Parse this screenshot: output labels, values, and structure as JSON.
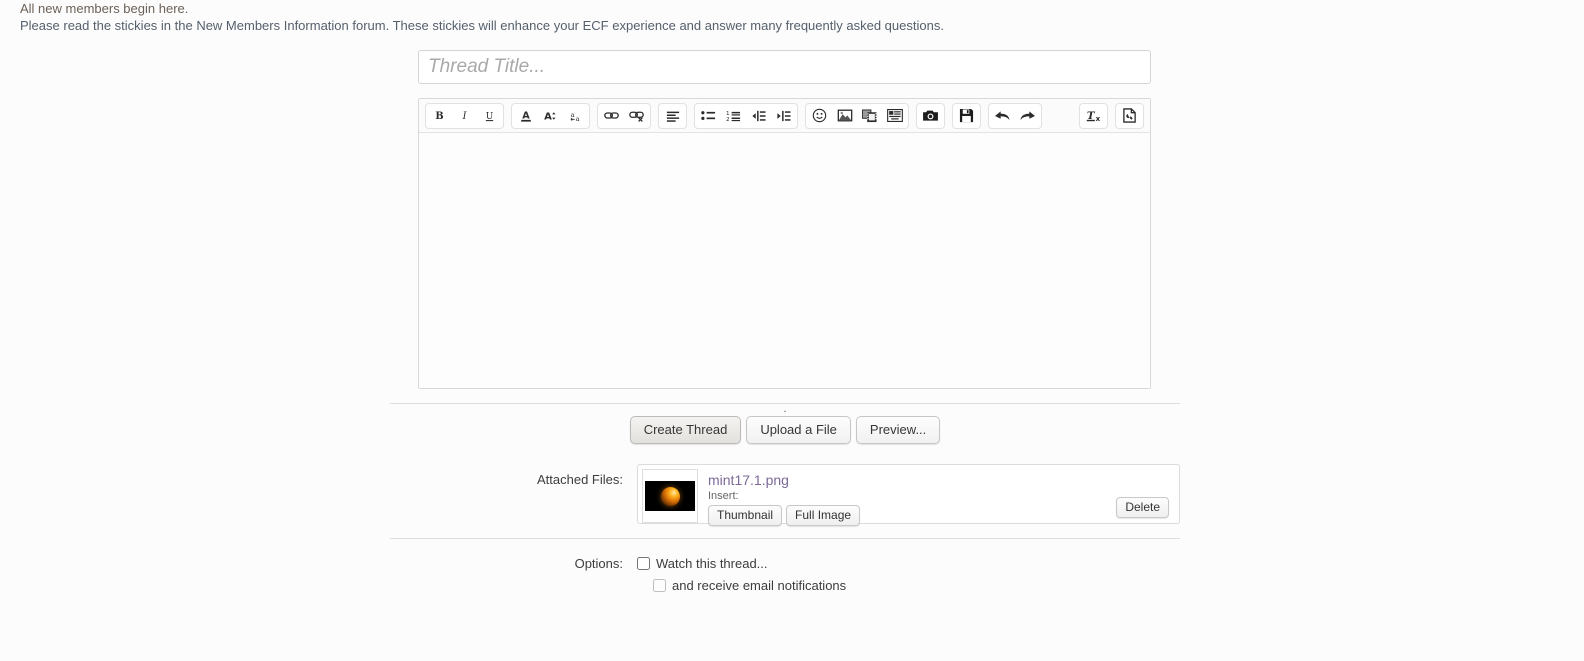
{
  "notice": {
    "line1": "All new members begin here.",
    "line2": "Please read the stickies in the New Members Information forum. These stickies will enhance your ECF experience and answer many frequently asked questions."
  },
  "thread": {
    "title_value": "",
    "title_placeholder": "Thread Title..."
  },
  "editor": {
    "content": "",
    "toolbar": {
      "groups": [
        {
          "name": "text-style",
          "buttons": [
            {
              "name": "bold-icon",
              "label": "B",
              "title": "Bold"
            },
            {
              "name": "italic-icon",
              "label": "I",
              "title": "Italic"
            },
            {
              "name": "underline-icon",
              "label": "U",
              "title": "Underline"
            }
          ]
        },
        {
          "name": "font",
          "buttons": [
            {
              "name": "text-color-icon",
              "label": "A",
              "title": "Text color"
            },
            {
              "name": "font-size-icon",
              "label": "A",
              "title": "Font size"
            },
            {
              "name": "font-family-icon",
              "label": "a",
              "title": "Font family"
            }
          ]
        },
        {
          "name": "link",
          "buttons": [
            {
              "name": "link-icon",
              "label": "",
              "title": "Insert link"
            },
            {
              "name": "unlink-icon",
              "label": "",
              "title": "Remove link"
            }
          ]
        },
        {
          "name": "align",
          "buttons": [
            {
              "name": "align-left-icon",
              "label": "",
              "title": "Alignment"
            }
          ]
        },
        {
          "name": "lists",
          "buttons": [
            {
              "name": "bullet-list-icon",
              "label": "",
              "title": "Bulleted list"
            },
            {
              "name": "numbered-list-icon",
              "label": "",
              "title": "Numbered list"
            },
            {
              "name": "outdent-icon",
              "label": "",
              "title": "Decrease indent"
            },
            {
              "name": "indent-icon",
              "label": "",
              "title": "Increase indent"
            }
          ]
        },
        {
          "name": "insert",
          "buttons": [
            {
              "name": "smiley-icon",
              "label": "",
              "title": "Insert smilies"
            },
            {
              "name": "image-icon",
              "label": "",
              "title": "Insert image"
            },
            {
              "name": "media-icon",
              "label": "",
              "title": "Insert media"
            },
            {
              "name": "quote-icon",
              "label": "",
              "title": "Insert quote"
            }
          ]
        },
        {
          "name": "camera",
          "buttons": [
            {
              "name": "camera-icon",
              "label": "",
              "title": "Take screenshot"
            }
          ]
        },
        {
          "name": "save",
          "buttons": [
            {
              "name": "save-floppy-icon",
              "label": "",
              "title": "Save draft"
            }
          ]
        },
        {
          "name": "history",
          "buttons": [
            {
              "name": "undo-icon",
              "label": "",
              "title": "Undo"
            },
            {
              "name": "redo-icon",
              "label": "",
              "title": "Redo"
            }
          ]
        }
      ],
      "right_groups": [
        {
          "name": "clear-format",
          "buttons": [
            {
              "name": "remove-formatting-icon",
              "label": "",
              "title": "Remove formatting"
            }
          ]
        },
        {
          "name": "draft",
          "buttons": [
            {
              "name": "draft-tools-icon",
              "label": "",
              "title": "Drafts"
            }
          ]
        }
      ]
    }
  },
  "actions": {
    "dot": ".",
    "create_thread": "Create Thread",
    "upload_file": "Upload a File",
    "preview": "Preview..."
  },
  "attachments": {
    "label": "Attached Files:",
    "items": [
      {
        "filename": "mint17.1.png",
        "insert_label": "Insert:",
        "thumbnail_button": "Thumbnail",
        "full_image_button": "Full Image",
        "delete_button": "Delete"
      }
    ]
  },
  "options": {
    "label": "Options:",
    "watch_thread": "Watch this thread...",
    "watch_thread_checked": false,
    "email_notifications": "and receive email notifications",
    "email_notifications_checked": false
  },
  "colors": {
    "page_background": "#fcfcfd",
    "link": "#7d6a99",
    "border": "#dcdcdc",
    "text": "#3d3d3d"
  }
}
